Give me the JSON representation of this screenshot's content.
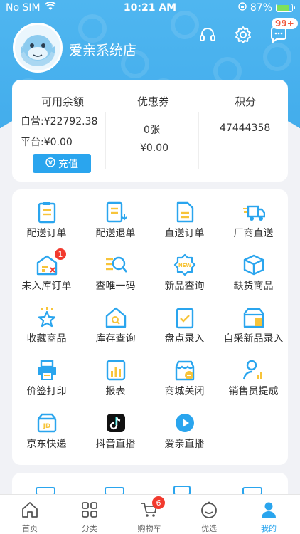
{
  "status_bar": {
    "carrier": "No SIM",
    "time": "10:21 AM",
    "battery_percent": "87%",
    "battery_level": 0.87,
    "icons": [
      "wifi-icon",
      "orientation-lock-icon",
      "battery-charging-icon"
    ]
  },
  "header": {
    "shop_name": "爱亲系统店",
    "message_badge": "99+",
    "icons": [
      "headset-icon",
      "gear-icon",
      "message-icon"
    ]
  },
  "balance": {
    "available_title": "可用余额",
    "self_operated": "自营:¥22792.38",
    "platform": "平台:¥0.00",
    "recharge_label": "充值",
    "coupon_title": "优惠券",
    "coupon_count": "0张",
    "coupon_amount": "¥0.00",
    "points_title": "积分",
    "points_value": "47444358"
  },
  "grid": [
    {
      "label": "配送订单",
      "icon": "clipboard-list-icon"
    },
    {
      "label": "配送退单",
      "icon": "return-list-icon"
    },
    {
      "label": "直送订单",
      "icon": "document-icon"
    },
    {
      "label": "厂商直送",
      "icon": "fast-truck-icon"
    },
    {
      "label": "未入库订单",
      "icon": "warehouse-x-icon",
      "badge": "1"
    },
    {
      "label": "查唯一码",
      "icon": "search-code-icon"
    },
    {
      "label": "新品查询",
      "icon": "new-badge-icon"
    },
    {
      "label": "缺货商品",
      "icon": "box-icon"
    },
    {
      "label": "收藏商品",
      "icon": "star-icon"
    },
    {
      "label": "库存查询",
      "icon": "house-search-icon"
    },
    {
      "label": "盘点录入",
      "icon": "check-clipboard-icon"
    },
    {
      "label": "自采新品录入",
      "icon": "register-box-icon"
    },
    {
      "label": "价签打印",
      "icon": "printer-icon"
    },
    {
      "label": "报表",
      "icon": "bar-report-icon"
    },
    {
      "label": "商城关闭",
      "icon": "shop-closed-icon"
    },
    {
      "label": "销售员提成",
      "icon": "salesperson-chart-icon"
    },
    {
      "label": "京东快递",
      "icon": "jd-express-icon"
    },
    {
      "label": "抖音直播",
      "icon": "tiktok-icon"
    },
    {
      "label": "爱亲直播",
      "icon": "live-play-icon"
    }
  ],
  "tabbar": {
    "home": "首页",
    "category": "分类",
    "cart": "购物车",
    "cart_badge": "6",
    "featured": "优选",
    "mine": "我的"
  },
  "colors": {
    "brand_blue": "#2aa5ee",
    "header_blue": "#4fb6f0",
    "badge_red": "#f23a2e",
    "icon_yellow": "#f7c43a"
  }
}
